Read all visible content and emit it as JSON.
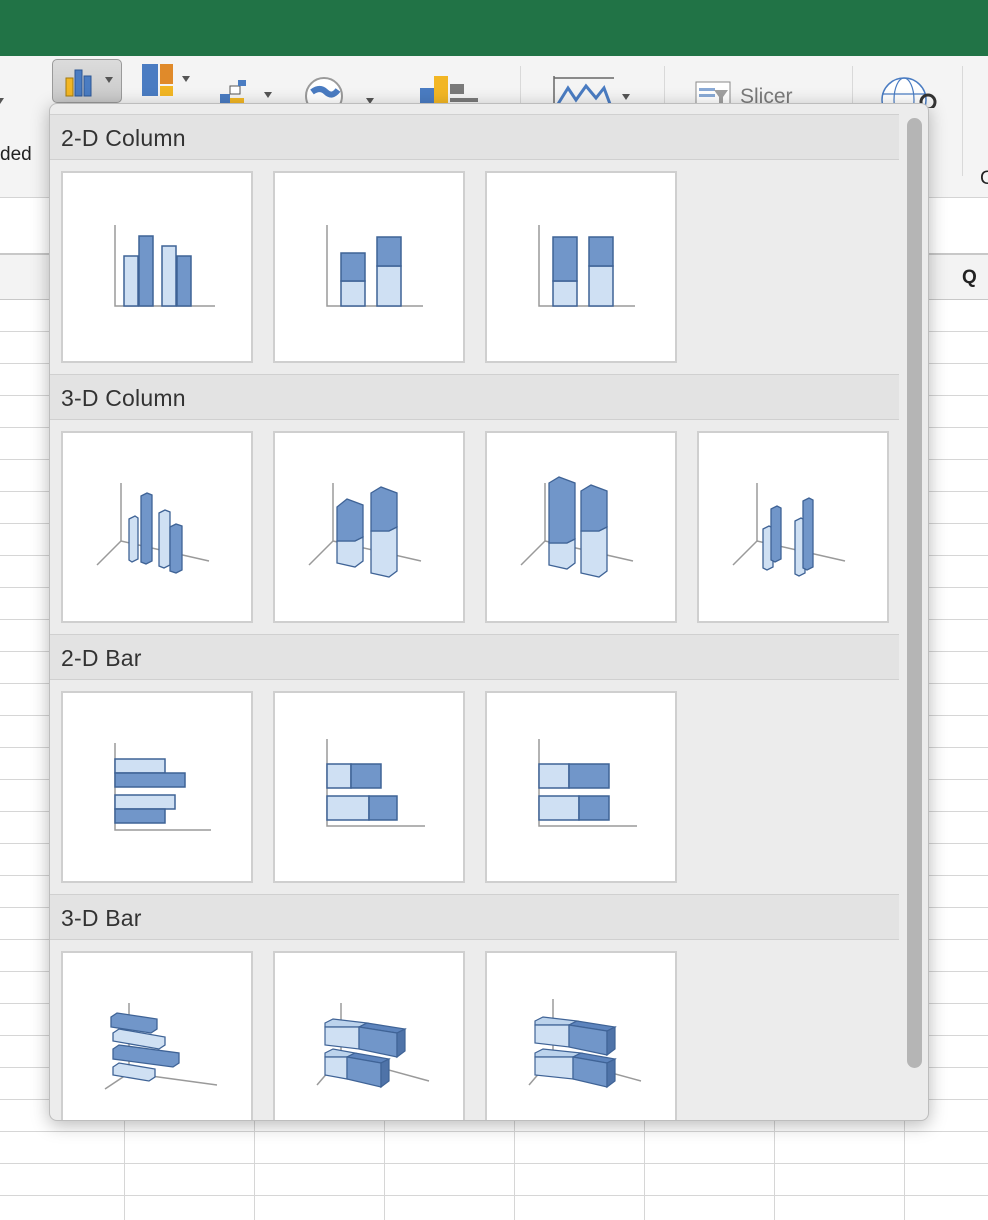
{
  "window": {
    "titlebar_color": "#217346"
  },
  "ribbon": {
    "left_partial_text": "ded",
    "right_partial_text": "C",
    "slicer_label": "Slicer",
    "icons": [
      "column-chart-icon",
      "hierarchy-chart-icon",
      "waterfall-chart-icon",
      "map-chart-icon",
      "pivot-chart-icon",
      "sparkline-icon",
      "slicer-icon",
      "globe-link-icon"
    ]
  },
  "sheet": {
    "column_header_visible": "Q"
  },
  "chart_gallery": {
    "accent_dark": "#7196c9",
    "accent_light": "#cfe0f3",
    "outline": "#3f6396",
    "sections": [
      {
        "title": "2-D Column",
        "items": [
          "clustered-column",
          "stacked-column",
          "100-stacked-column"
        ]
      },
      {
        "title": "3-D Column",
        "items": [
          "3d-clustered-column",
          "3d-stacked-column",
          "3d-100-stacked-column",
          "3d-column"
        ]
      },
      {
        "title": "2-D Bar",
        "items": [
          "clustered-bar",
          "stacked-bar",
          "100-stacked-bar"
        ]
      },
      {
        "title": "3-D Bar",
        "items": [
          "3d-clustered-bar",
          "3d-stacked-bar",
          "3d-100-stacked-bar"
        ]
      }
    ]
  }
}
